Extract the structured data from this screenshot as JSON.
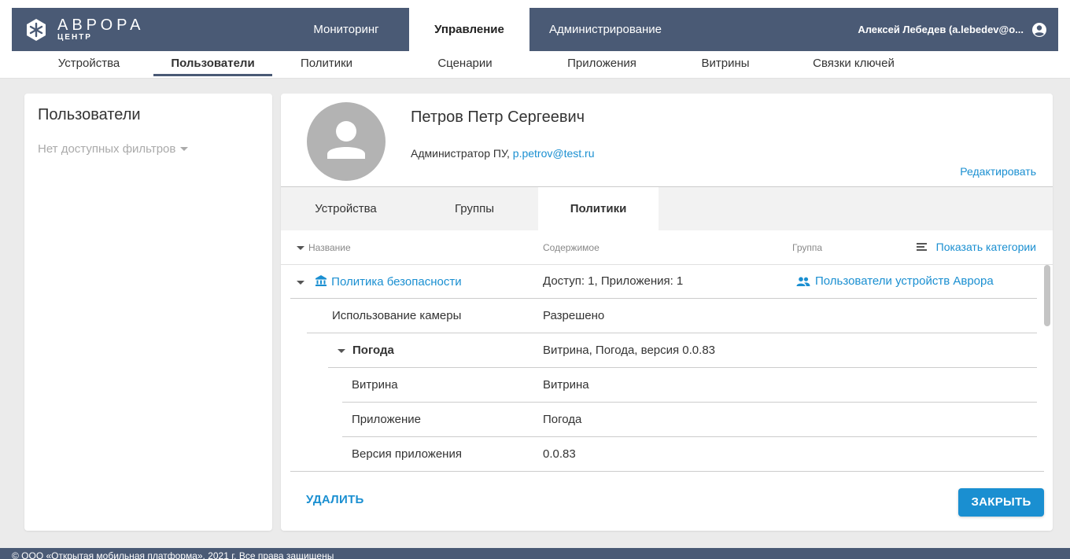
{
  "brand": {
    "title": "АВРОРА",
    "subtitle": "ЦЕНТР"
  },
  "topnav": {
    "items": [
      {
        "label": "Мониторинг",
        "active": false
      },
      {
        "label": "Управление",
        "active": true
      },
      {
        "label": "Администрирование",
        "active": false
      }
    ],
    "user": "Алексей Лебедев (a.lebedev@o..."
  },
  "subnav": {
    "items": [
      {
        "label": "Устройства"
      },
      {
        "label": "Пользователи",
        "active": true
      },
      {
        "label": "Политики"
      },
      {
        "label": "Сценарии"
      },
      {
        "label": "Приложения"
      },
      {
        "label": "Витрины"
      },
      {
        "label": "Связки ключей"
      }
    ]
  },
  "left_panel": {
    "title": "Пользователи",
    "filter": "Нет доступных фильтров"
  },
  "profile": {
    "name": "Петров Петр Сергеевич",
    "role": "Администратор ПУ,",
    "email": "p.petrov@test.ru",
    "edit": "Редактировать"
  },
  "tabs": [
    {
      "label": "Устройства"
    },
    {
      "label": "Группы"
    },
    {
      "label": "Политики",
      "active": true
    }
  ],
  "table": {
    "headers": {
      "name": "Название",
      "content": "Содержимое",
      "group": "Группа"
    },
    "show_categories": "Показать категории",
    "rows": [
      {
        "name": "Политика безопасности",
        "content": "Доступ: 1, Приложения: 1",
        "group": "Пользователи устройств Аврора"
      },
      {
        "name": "Использование камеры",
        "content": "Разрешено"
      },
      {
        "name": "Погода",
        "content": "Витрина, Погода, версия 0.0.83"
      },
      {
        "name": "Витрина",
        "content": "Витрина"
      },
      {
        "name": "Приложение",
        "content": "Погода"
      },
      {
        "name": "Версия приложения",
        "content": "0.0.83"
      }
    ]
  },
  "actions": {
    "delete": "УДАЛИТЬ",
    "close": "ЗАКРЫТЬ"
  },
  "footer": "© ООО «Открытая мобильная платформа», 2021 г. Все права защищены"
}
